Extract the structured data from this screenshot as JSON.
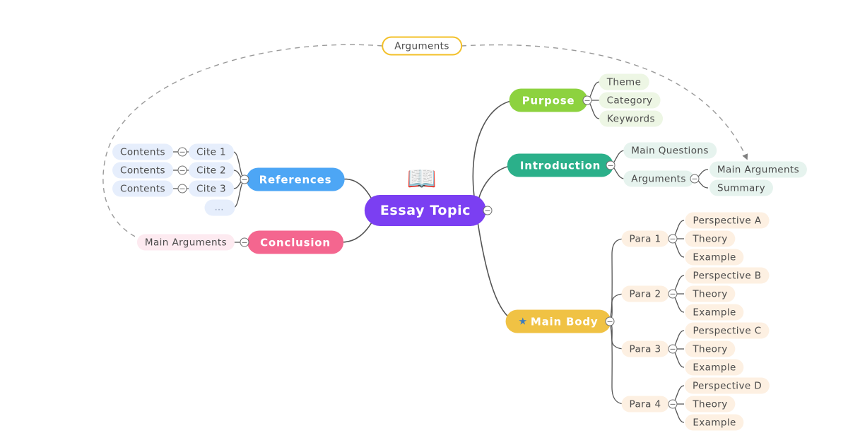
{
  "mindmap": {
    "root": {
      "label": "Essay Topic",
      "icon": "open-book-icon",
      "icon_glyph": "📖",
      "color": "#7b3ff2",
      "toggle": "collapse-toggle"
    },
    "floating_topic": {
      "label": "Arguments",
      "border_color": "#f3c028",
      "relation_targets": [
        "Main Arguments (Conclusion)",
        "Main Arguments (Introduction)"
      ]
    },
    "branches": [
      {
        "label": "Purpose",
        "color": "#8dd23f",
        "side": "right",
        "children": [
          {
            "label": "Theme"
          },
          {
            "label": "Category"
          },
          {
            "label": "Keywords"
          }
        ]
      },
      {
        "label": "Introduction",
        "color": "#2bb08a",
        "side": "right",
        "children": [
          {
            "label": "Main Questions"
          },
          {
            "label": "Arguments",
            "children": [
              {
                "label": "Main Arguments"
              },
              {
                "label": "Summary"
              }
            ]
          }
        ]
      },
      {
        "label": "Main Body",
        "color": "#f0c244",
        "side": "right",
        "icon": "star-icon",
        "icon_glyph": "★",
        "children": [
          {
            "label": "Para 1",
            "children": [
              {
                "label": "Perspective A"
              },
              {
                "label": "Theory"
              },
              {
                "label": "Example"
              }
            ]
          },
          {
            "label": "Para 2",
            "children": [
              {
                "label": "Perspective B"
              },
              {
                "label": "Theory"
              },
              {
                "label": "Example"
              }
            ]
          },
          {
            "label": "Para 3",
            "children": [
              {
                "label": "Perspective C"
              },
              {
                "label": "Theory"
              },
              {
                "label": "Example"
              }
            ]
          },
          {
            "label": "Para 4",
            "children": [
              {
                "label": "Perspective D"
              },
              {
                "label": "Theory"
              },
              {
                "label": "Example"
              }
            ]
          }
        ]
      },
      {
        "label": "References",
        "color": "#4da6f5",
        "side": "left",
        "children": [
          {
            "label": "Cite 1",
            "children": [
              {
                "label": "Contents"
              }
            ]
          },
          {
            "label": "Cite 2",
            "children": [
              {
                "label": "Contents"
              }
            ]
          },
          {
            "label": "Cite 3",
            "children": [
              {
                "label": "Contents"
              }
            ]
          },
          {
            "label": "…"
          }
        ]
      },
      {
        "label": "Conclusion",
        "color": "#f4668f",
        "side": "left",
        "children": [
          {
            "label": "Main Arguments"
          }
        ]
      }
    ]
  }
}
